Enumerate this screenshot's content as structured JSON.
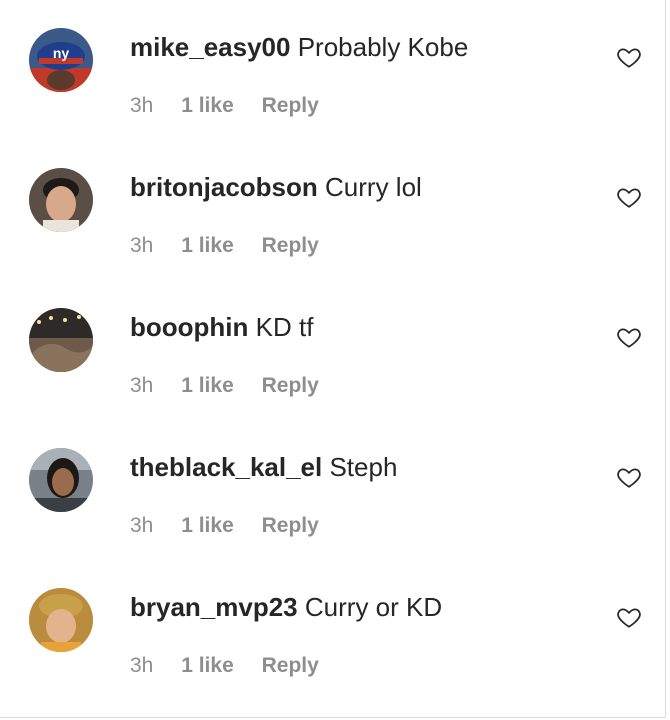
{
  "comments": [
    {
      "username": "mike_easy00",
      "text": "Probably Kobe",
      "time": "3h",
      "likes": "1 like",
      "reply": "Reply",
      "avatar_icon": "avatar-giants-cap"
    },
    {
      "username": "britonjacobson",
      "text": "Curry lol",
      "time": "3h",
      "likes": "1 like",
      "reply": "Reply",
      "avatar_icon": "avatar-face"
    },
    {
      "username": "booophin",
      "text": "KD tf",
      "time": "3h",
      "likes": "1 like",
      "reply": "Reply",
      "avatar_icon": "avatar-outdoor-scene"
    },
    {
      "username": "theblack_kal_el",
      "text": "Steph",
      "time": "3h",
      "likes": "1 like",
      "reply": "Reply",
      "avatar_icon": "avatar-face-car"
    },
    {
      "username": "bryan_mvp23",
      "text": "Curry or KD",
      "time": "3h",
      "likes": "1 like",
      "reply": "Reply",
      "avatar_icon": "avatar-face-hat"
    }
  ],
  "colors": {
    "text": "#262626",
    "muted": "#8e8e8e",
    "border": "#dbdbdb"
  },
  "icons": {
    "like": "heart-outline-icon"
  }
}
